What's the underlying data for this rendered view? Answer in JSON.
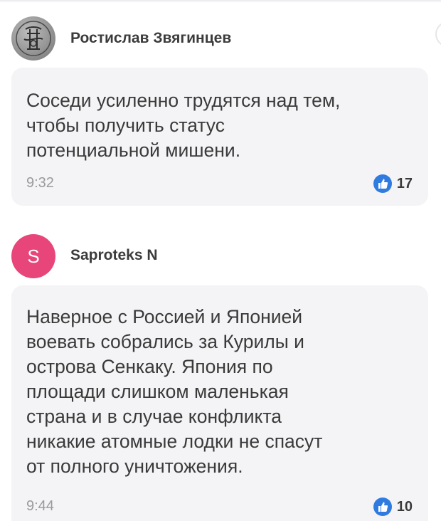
{
  "comments": [
    {
      "author": "Ростислав Звягинцев",
      "avatar_icon": "monogram-avatar-icon",
      "text_lines": [
        "Соседи усиленно трудятся над тем,",
        "чтобы получить статус",
        "потенциальной мишени."
      ],
      "time": "9:32",
      "likes": "17"
    },
    {
      "author": "Saproteks N",
      "avatar_letter": "S",
      "avatar_color": "#e8467a",
      "text_lines": [
        "Наверное с Россией и Японией",
        "воевать собрались за Курилы и",
        "острова Сенкаку. Япония по",
        "площади слишком маленькая",
        "страна и в случае конфликта",
        "никакие атомные лодки не спасут",
        "от полного уничтожения."
      ],
      "time": "9:44",
      "likes": "10"
    }
  ],
  "colors": {
    "bubble_bg": "#f4f4f6",
    "like_icon": "#2f7be0",
    "text": "#3a3a3a",
    "time": "#9a9a9e"
  }
}
